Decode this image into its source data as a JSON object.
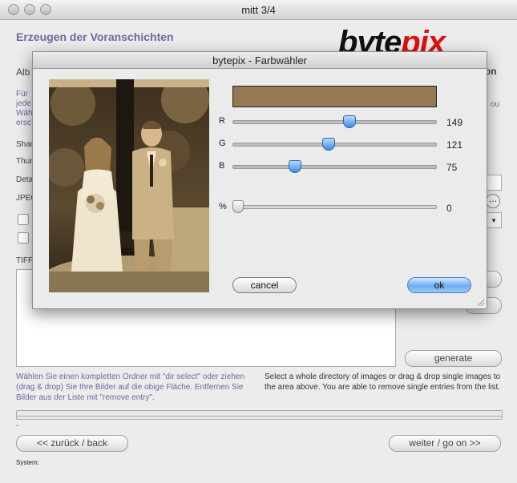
{
  "window": {
    "title": "mitt 3/4"
  },
  "page": {
    "title": "Erzeugen der Voranschichten"
  },
  "logo": {
    "text_main": "byte",
    "text_accent": "pix"
  },
  "background": {
    "partial_top_left": "Alb",
    "partial_top_right": "on",
    "partial_text_lines": [
      "Für",
      "jede",
      "Wäh",
      "ersc"
    ],
    "partial_right_text": "ou",
    "labels": [
      "Shar",
      "Thur",
      "Deta",
      "JPEG"
    ],
    "tiff_label": "TIFF",
    "ellipsis_button": "…"
  },
  "help": {
    "de": "Wählen Sie einen kompletten Ordner mit \"dir select\" oder ziehen (drag & drop) Sie Ihre Bilder auf die obige Fläche. Entfernen Sie Bilder aus der Liste mit \"remove entry\".",
    "en": "Select a whole directory of images or drag & drop single images to the area above. You are able to remove single entries from the list."
  },
  "buttons": {
    "generate": "generate",
    "back": "<< zurück / back",
    "next": "weiter / go on >>"
  },
  "status": {
    "dash": "-",
    "system_label": "System:"
  },
  "dialog": {
    "title": "bytepix - Farbwähler",
    "swatch_color": "#957955",
    "sliders": {
      "r": {
        "label": "R",
        "value": 149
      },
      "g": {
        "label": "G",
        "value": 121
      },
      "b": {
        "label": "B",
        "value": 75
      },
      "percent": {
        "label": "%",
        "value": 0
      }
    },
    "cancel": "cancel",
    "ok": "ok"
  }
}
